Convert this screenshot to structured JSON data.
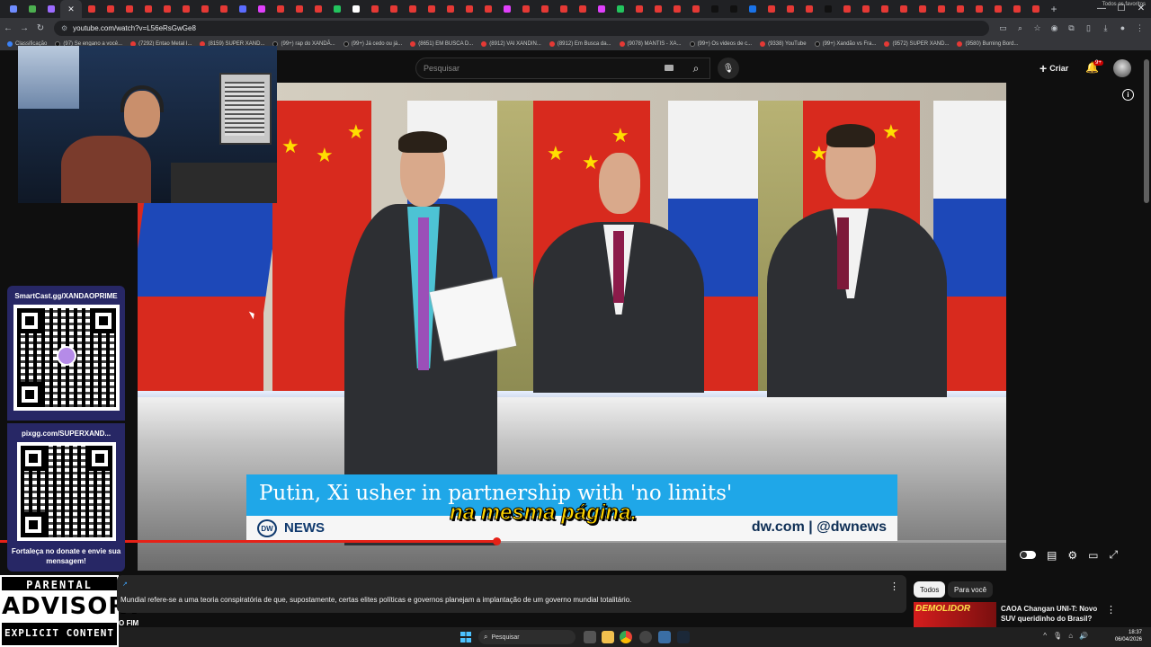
{
  "browser": {
    "url": "youtube.com/watch?v=L56eRsGwGe8",
    "tab_colors": [
      "#6f8cff",
      "#4caf50",
      "#9c6bff",
      "#e8eaed",
      "#e53935",
      "#e53935",
      "#e53935",
      "#e53935",
      "#e53935",
      "#e53935",
      "#e53935",
      "#e53935",
      "#5b6cff",
      "#e040fb",
      "#e53935",
      "#e53935",
      "#e53935",
      "#23c45e",
      "#ffffff",
      "#e53935",
      "#e53935",
      "#e53935",
      "#e53935",
      "#e53935",
      "#e53935",
      "#e53935",
      "#e040fb",
      "#e53935",
      "#e53935",
      "#e53935",
      "#e53935",
      "#e040fb",
      "#23c45e",
      "#e53935",
      "#e53935",
      "#e53935",
      "#e53935",
      "#111111",
      "#111111",
      "#1a73e8",
      "#e53935",
      "#e53935",
      "#e53935",
      "#111111",
      "#e53935",
      "#e53935",
      "#e53935",
      "#e53935",
      "#e53935",
      "#e53935",
      "#e53935",
      "#e53935",
      "#e53935",
      "#e53935",
      "#e53935"
    ],
    "bookmarks": [
      {
        "label": "Classificação",
        "kind": "blue"
      },
      {
        "label": "(97) Se engano a você...",
        "kind": "dark"
      },
      {
        "label": "(7292) Entao Metal I...",
        "kind": "red"
      },
      {
        "label": "(8159) SUPER XAND...",
        "kind": "red"
      },
      {
        "label": "(99+) rap do XANDÃ...",
        "kind": "dark"
      },
      {
        "label": "(99+) Já cedo ou já...",
        "kind": "dark"
      },
      {
        "label": "(8651) EM BUSCA D...",
        "kind": "red"
      },
      {
        "label": "(8912) VAI XANDIN...",
        "kind": "red"
      },
      {
        "label": "(8912) Em Busca da...",
        "kind": "red"
      },
      {
        "label": "(9078) MANTIS - XA...",
        "kind": "red"
      },
      {
        "label": "(99+) Os videos de c...",
        "kind": "dark"
      },
      {
        "label": "(9338) YouTube",
        "kind": "red"
      },
      {
        "label": "(99+) Xandão vs Fra...",
        "kind": "dark"
      },
      {
        "label": "(9572) SUPER XAND...",
        "kind": "red"
      },
      {
        "label": "(9580) Burning Bord...",
        "kind": "red"
      }
    ],
    "all_bookmarks": "Todos os favoritos"
  },
  "youtube": {
    "search_placeholder": "Pesquisar",
    "create_label": "Criar",
    "notifications_badge": "9+",
    "video": {
      "headline": "Putin, Xi usher in partnership with 'no limits'",
      "network": "NEWS",
      "network_logo": "DW",
      "handle": "dw.com | @dwnews",
      "caption": "na mesma página.",
      "progress_fraction": 0.493
    },
    "description_text": "Mundial refere-se a uma teoria conspiratória de que, supostamente, certas elites políticas e governos planejam a implantação de um governo mundial totalitário.",
    "next_heading": "O FIM",
    "chips": [
      "Todos",
      "Para você"
    ],
    "recommendation": {
      "title": "CAOA Changan UNI-T: Novo SUV queridinho do Brasil? ...",
      "thumb_text": "DEMOLIDOR"
    }
  },
  "overlay": {
    "smartcast": "SmartCast.gg/XANDAOPRIME",
    "pixgg": "pixgg.com/SUPERXAND...",
    "note": "Fortaleça no donate e envie sua mensagem!",
    "advisory_top": "PARENTAL",
    "advisory_mid": "ADVISORY",
    "advisory_bot": "EXPLICIT CONTENT"
  },
  "taskbar": {
    "search_label": "Pesquisar",
    "time": "18:37",
    "date": "06/04/2026"
  },
  "colors": {
    "accent_red": "#e62117",
    "dw_blue": "#1fa7e8",
    "caption_yellow": "#ffd400",
    "qr_panel": "#272765"
  }
}
